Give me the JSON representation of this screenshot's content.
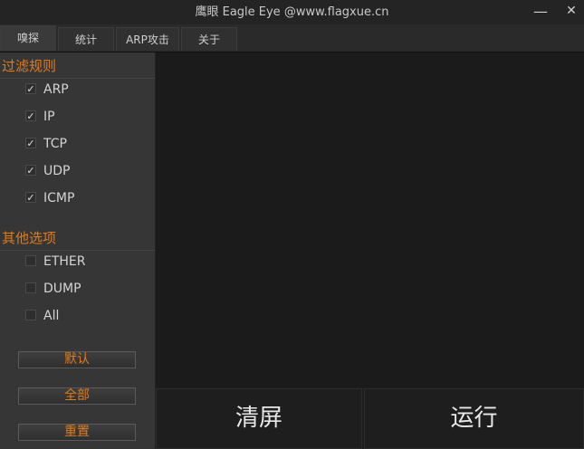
{
  "window": {
    "title": "鹰眼  Eagle Eye @www.flagxue.cn",
    "minimize_glyph": "—",
    "close_glyph": "✕"
  },
  "tabs": [
    {
      "label": "嗅探",
      "active": true
    },
    {
      "label": "统计",
      "active": false
    },
    {
      "label": "ARP攻击",
      "active": false
    },
    {
      "label": "关于",
      "active": false
    }
  ],
  "sidebar": {
    "filter_title": "过滤规则",
    "filters": [
      {
        "label": "ARP",
        "checked": true
      },
      {
        "label": "IP",
        "checked": true
      },
      {
        "label": "TCP",
        "checked": true
      },
      {
        "label": "UDP",
        "checked": true
      },
      {
        "label": "ICMP",
        "checked": true
      }
    ],
    "options_title": "其他选项",
    "options": [
      {
        "label": "ETHER",
        "checked": false
      },
      {
        "label": "DUMP",
        "checked": false
      },
      {
        "label": "All",
        "checked": false
      }
    ],
    "buttons": {
      "default": "默认",
      "all": "全部",
      "reset": "重置"
    }
  },
  "actions": {
    "clear": "清屏",
    "run": "运行"
  },
  "colors": {
    "accent": "#e07b1a",
    "background": "#1e1e1e",
    "sidebar": "#363636"
  }
}
